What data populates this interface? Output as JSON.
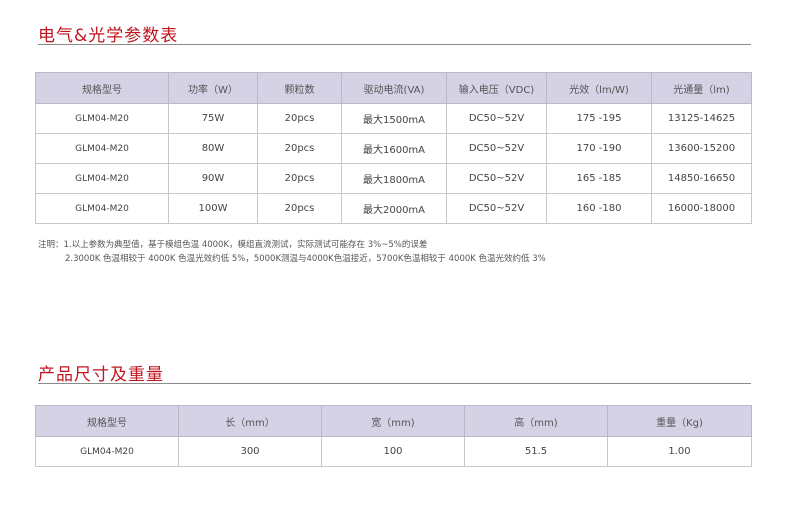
{
  "section1": {
    "title": "电气&光学参数表",
    "headers": [
      "规格型号",
      "功率（W）",
      "颗粒数",
      "驱动电流(VA)",
      "输入电压（VDC)",
      "光效（lm/W)",
      "光通量（lm)"
    ],
    "rows": [
      [
        "GLM04-M20",
        "75W",
        "20pcs",
        "最大1500mA",
        "DC50~52V",
        "175 -195",
        "13125-14625"
      ],
      [
        "GLM04-M20",
        "80W",
        "20pcs",
        "最大1600mA",
        "DC50~52V",
        "170 -190",
        "13600-15200"
      ],
      [
        "GLM04-M20",
        "90W",
        "20pcs",
        "最大1800mA",
        "DC50~52V",
        "165 -185",
        "14850-16650"
      ],
      [
        "GLM04-M20",
        "100W",
        "20pcs",
        "最大2000mA",
        "DC50~52V",
        "160 -180",
        "16000-18000"
      ]
    ],
    "notes": [
      "注明：1.以上参数为典型值，基于模组色温 4000K，模组直流测试，实际测试可能存在 3%~5%的误差",
      "2.3000K 色温相较于 4000K 色温光效约低 5%，5000K测温与4000K色温接近，5700K色温相较于 4000K 色温光效约低 3%"
    ]
  },
  "section2": {
    "title": "产品尺寸及重量",
    "headers": [
      "规格型号",
      "长（mm）",
      "宽（mm)",
      "高（mm)",
      "重量（Kg)"
    ],
    "rows": [
      [
        "GLM04-M20",
        "300",
        "100",
        "51.5",
        "1.00"
      ]
    ]
  },
  "colors": {
    "title": "#c0151f",
    "header_bg": "#d5d2e6"
  }
}
